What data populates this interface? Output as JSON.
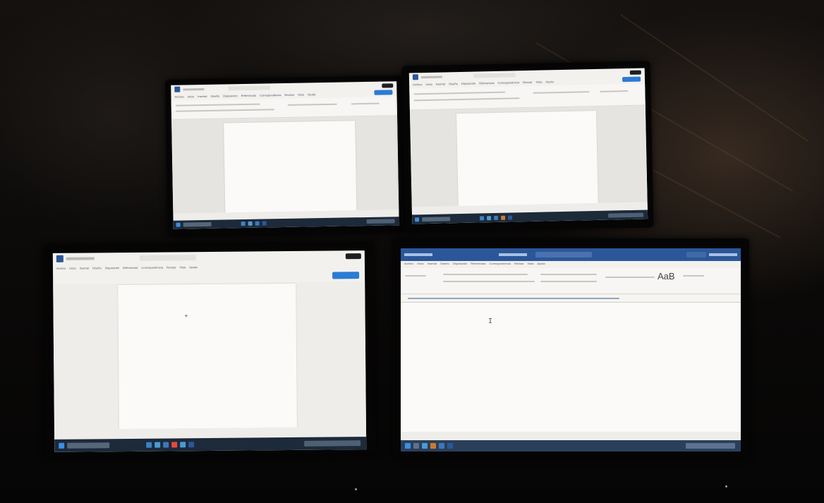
{
  "scene": {
    "colors": {
      "word_blue": "#2b579a",
      "taskbar": "#1c2a3a",
      "share_blue": "#2b7cd3",
      "paper": "#fbfaf8"
    }
  },
  "laptops": [
    {
      "id": "top-left",
      "ribbon_tabs": [
        "Archivo",
        "Inicio",
        "Insertar",
        "Diseño",
        "Disposición",
        "Referencias",
        "Correspondencia",
        "Revisar",
        "Vista",
        "Ayuda"
      ]
    },
    {
      "id": "top-right",
      "ribbon_tabs": [
        "Archivo",
        "Inicio",
        "Insertar",
        "Diseño",
        "Disposición",
        "Referencias",
        "Correspondencia",
        "Revisar",
        "Vista",
        "Ayuda"
      ]
    },
    {
      "id": "bottom-left",
      "ribbon_tabs": [
        "Archivo",
        "Inicio",
        "Insertar",
        "Diseño",
        "Disposición",
        "Referencias",
        "Correspondencia",
        "Revisar",
        "Vista",
        "Ayuda"
      ]
    },
    {
      "id": "bottom-right",
      "ribbon_tabs": [
        "Archivo",
        "Inicio",
        "Insertar",
        "Diseño",
        "Disposición",
        "Referencias",
        "Correspondencia",
        "Revisar",
        "Vista",
        "Ayuda"
      ],
      "style_sample": "AaB",
      "cursor_glyph": "I"
    }
  ]
}
